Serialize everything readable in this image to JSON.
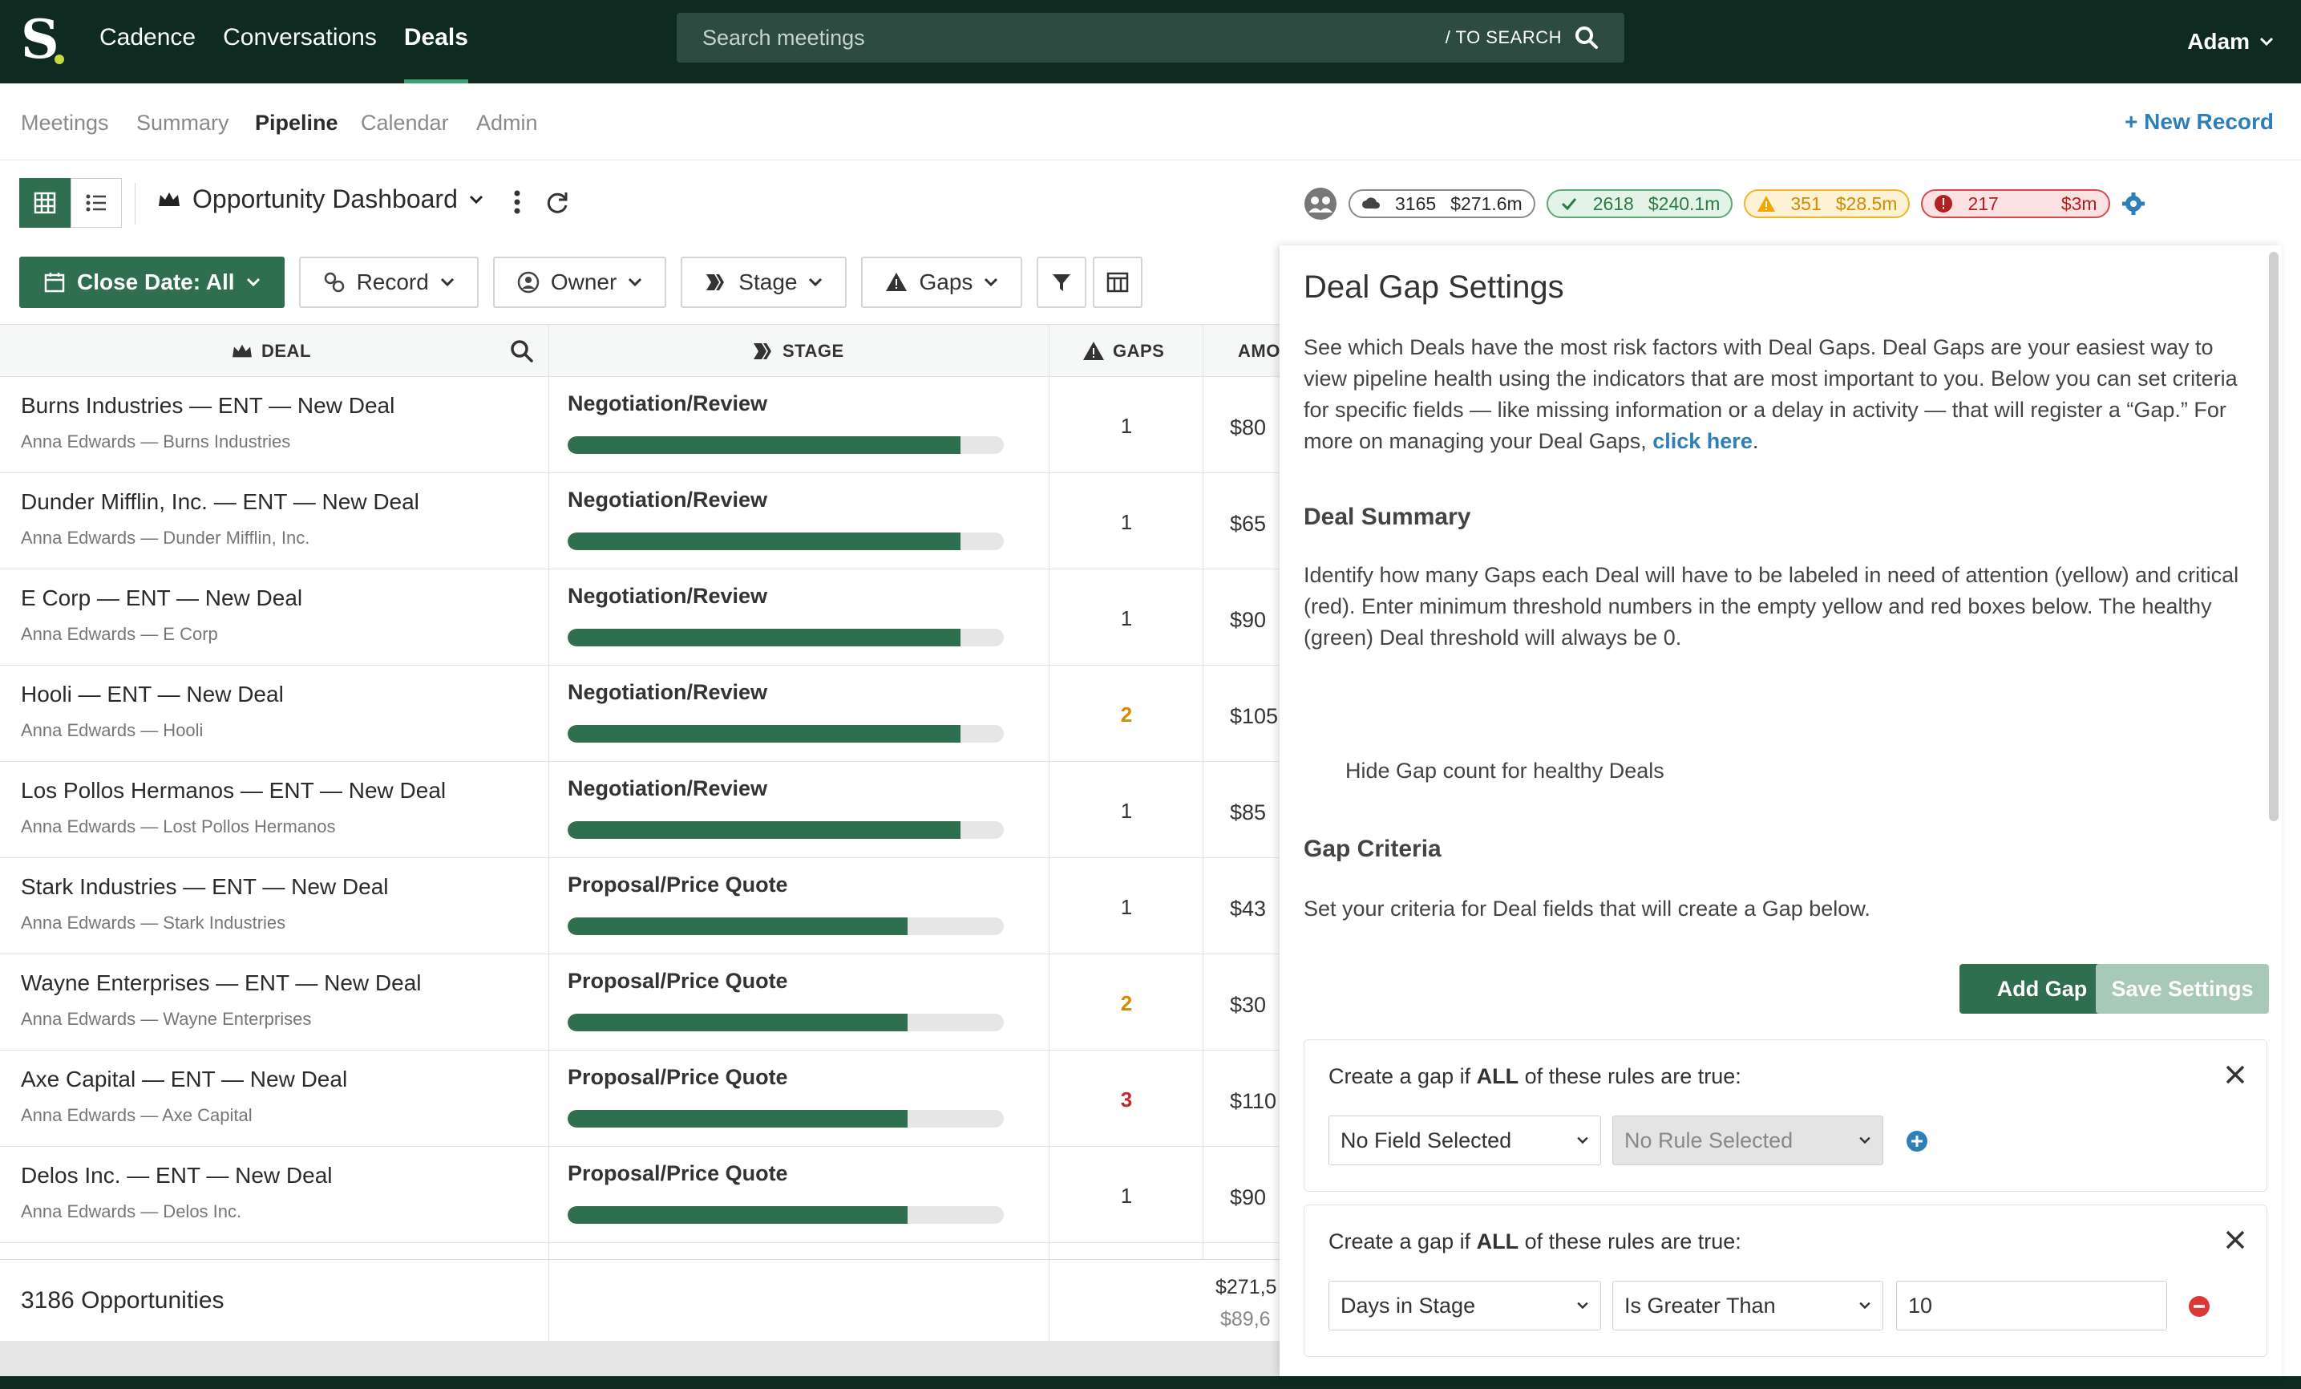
{
  "topnav": {
    "links": [
      "Cadence",
      "Conversations",
      "Deals"
    ],
    "search_placeholder": "Search meetings",
    "search_hint": "/ TO SEARCH",
    "user": "Adam"
  },
  "subnav": {
    "tabs": [
      "Meetings",
      "Summary",
      "Pipeline",
      "Calendar",
      "Admin"
    ],
    "new_record": "New Record"
  },
  "dashboard": {
    "title": "Opportunity Dashboard"
  },
  "stats": {
    "all": {
      "count": "3165",
      "amount": "$271.6m"
    },
    "healthy": {
      "count": "2618",
      "amount": "$240.1m"
    },
    "attention": {
      "count": "351",
      "amount": "$28.5m"
    },
    "critical": {
      "count": "217",
      "amount": "$3m"
    }
  },
  "filters": {
    "close_date": "Close Date: All",
    "record": "Record",
    "owner": "Owner",
    "stage": "Stage",
    "gaps": "Gaps"
  },
  "table": {
    "headers": {
      "deal": "DEAL",
      "stage": "STAGE",
      "gaps": "GAPS",
      "amount": "AMO"
    },
    "rows": [
      {
        "title": "Burns Industries — ENT — New Deal",
        "sub": "Anna Edwards — Burns Industries",
        "stage": "Negotiation/Review",
        "progress": 0.9,
        "gaps": "1",
        "amount": "$80"
      },
      {
        "title": "Dunder Mifflin, Inc. — ENT — New Deal",
        "sub": "Anna Edwards — Dunder Mifflin, Inc.",
        "stage": "Negotiation/Review",
        "progress": 0.9,
        "gaps": "1",
        "amount": "$65"
      },
      {
        "title": "E Corp — ENT — New Deal",
        "sub": "Anna Edwards — E Corp",
        "stage": "Negotiation/Review",
        "progress": 0.9,
        "gaps": "1",
        "amount": "$90"
      },
      {
        "title": "Hooli — ENT — New Deal",
        "sub": "Anna Edwards — Hooli",
        "stage": "Negotiation/Review",
        "progress": 0.9,
        "gaps": "2",
        "amount": "$105"
      },
      {
        "title": "Los Pollos Hermanos — ENT — New Deal",
        "sub": "Anna Edwards — Lost Pollos Hermanos",
        "stage": "Negotiation/Review",
        "progress": 0.9,
        "gaps": "1",
        "amount": "$85"
      },
      {
        "title": "Stark Industries — ENT — New Deal",
        "sub": "Anna Edwards — Stark Industries",
        "stage": "Proposal/Price Quote",
        "progress": 0.78,
        "gaps": "1",
        "amount": "$43"
      },
      {
        "title": "Wayne Enterprises — ENT — New Deal",
        "sub": "Anna Edwards — Wayne Enterprises",
        "stage": "Proposal/Price Quote",
        "progress": 0.78,
        "gaps": "2",
        "amount": "$30"
      },
      {
        "title": "Axe Capital — ENT — New Deal",
        "sub": "Anna Edwards — Axe Capital",
        "stage": "Proposal/Price Quote",
        "progress": 0.78,
        "gaps": "3",
        "amount": "$110"
      },
      {
        "title": "Delos Inc. — ENT — New Deal",
        "sub": "Anna Edwards — Delos Inc.",
        "stage": "Proposal/Price Quote",
        "progress": 0.78,
        "gaps": "1",
        "amount": "$90"
      }
    ],
    "footer": {
      "count": "3186 Opportunities",
      "amount_total": "$271,5",
      "amount_sub": "$89,6"
    }
  },
  "panel": {
    "title": "Deal Gap Settings",
    "intro": "See which Deals have the most risk factors with Deal Gaps. Deal Gaps are your easiest way to view pipeline health using the indicators that are most important to you. Below you can set criteria for specific fields — like missing information or a delay in activity — that will register a “Gap.” For more on managing your Deal Gaps,",
    "intro_link": "click here",
    "summary_heading": "Deal Summary",
    "summary_text": "Identify how many Gaps each Deal will have to be labeled in need of attention (yellow) and critical (red). Enter minimum threshold numbers in the empty yellow and red boxes below. The healthy (green) Deal threshold will always be 0.",
    "hide_label": "Hide Gap count for healthy Deals",
    "criteria_heading": "Gap Criteria",
    "criteria_text": "Set your criteria for Deal fields that will create a Gap below.",
    "add_gap": "Add Gap",
    "save_settings": "Save Settings",
    "rules": [
      {
        "prefix": "Create a gap if ",
        "bold": "ALL",
        "suffix": " of these rules are true:",
        "field": "No Field Selected",
        "rule": "No Rule Selected",
        "value": ""
      },
      {
        "prefix": "Create a gap if ",
        "bold": "ALL",
        "suffix": " of these rules are true:",
        "field": "Days in Stage",
        "rule": "Is Greater Than",
        "value": "10"
      }
    ]
  },
  "colors": {
    "brand_dark": "#0e2a21",
    "accent_green": "#2f6e4f",
    "link_blue": "#2e7fb8"
  }
}
